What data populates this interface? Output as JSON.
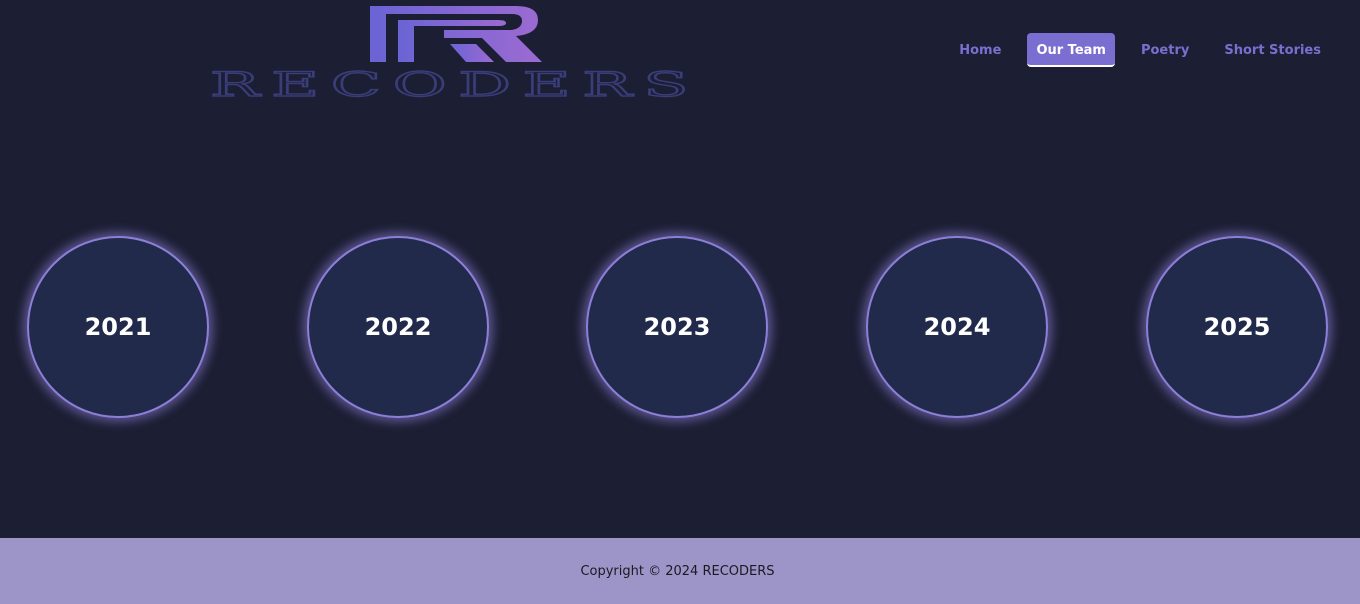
{
  "brand": {
    "name": "RECODERS",
    "logo_letter": "R",
    "accent": "#7a6fd0",
    "logo_gradient": [
      "#6a64d4",
      "#9c6ad2"
    ]
  },
  "nav": {
    "items": [
      {
        "label": "Home",
        "active": false
      },
      {
        "label": "Our Team",
        "active": true
      },
      {
        "label": "Poetry",
        "active": false
      },
      {
        "label": "Short Stories",
        "active": false
      }
    ]
  },
  "years": [
    {
      "label": "2021"
    },
    {
      "label": "2022"
    },
    {
      "label": "2023"
    },
    {
      "label": "2024"
    },
    {
      "label": "2025"
    }
  ],
  "footer": {
    "copyright": "Copyright © 2024 RECODERS"
  },
  "colors": {
    "background": "#1c1e33",
    "circle_fill": "#222a4c",
    "circle_glow": "#8c7fd8",
    "footer_bg": "#9d95c8"
  }
}
